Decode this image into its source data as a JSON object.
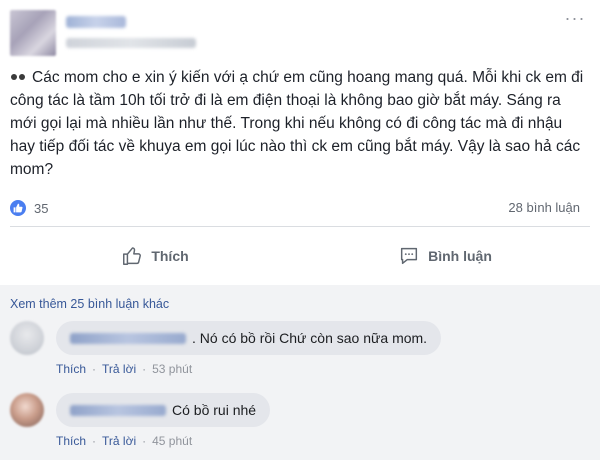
{
  "post": {
    "text": "Các mom cho e xin ý kiến với ạ chứ em cũng hoang mang quá. Mỗi khi ck em đi công tác là tầm 10h tối trở đi là em điện thoại là không bao giờ bắt máy. Sáng ra mới gọi lại mà nhiều lần như thế. Trong khi nếu không có đi công tác mà đi nhậu hay tiếp đối tác về khuya em gọi lúc nào thì ck em cũng bắt máy. Vậy là sao hả các mom?",
    "more_icon": "ellipsis-icon"
  },
  "stats": {
    "likes": "35",
    "comments": "28 bình luận"
  },
  "actions": {
    "like_label": "Thích",
    "comment_label": "Bình luận"
  },
  "comments_section": {
    "see_more": "Xem thêm 25 bình luận khác",
    "items": [
      {
        "text": ". Nó có bồ rồi Chứ còn sao nữa mom.",
        "like": "Thích",
        "reply": "Trả lời",
        "time": "53 phút"
      },
      {
        "text": "Có bồ rui nhé",
        "like": "Thích",
        "reply": "Trả lời",
        "time": "45 phút"
      }
    ]
  },
  "colors": {
    "accent": "#4a7ef0",
    "link": "#385898",
    "bubble": "#e4e6eb",
    "comments_bg": "#f2f3f5"
  }
}
